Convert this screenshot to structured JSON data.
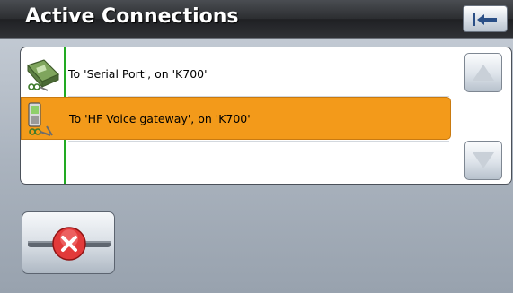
{
  "header": {
    "title": "Active Connections",
    "back_icon": "back-arrow-icon"
  },
  "connections": [
    {
      "label": "To 'Serial Port', on 'K700'",
      "icon": "serial-port-icon",
      "selected": false
    },
    {
      "label": "To 'HF Voice gateway', on 'K700'",
      "icon": "phone-connection-icon",
      "selected": true
    }
  ],
  "scroll": {
    "up_icon": "arrow-up-icon",
    "down_icon": "arrow-down-icon"
  },
  "actions": {
    "cancel_icon": "disconnect-icon"
  },
  "colors": {
    "selection": "#f39a1a",
    "indicator": "#22aa22",
    "header": "#2c2e31"
  }
}
